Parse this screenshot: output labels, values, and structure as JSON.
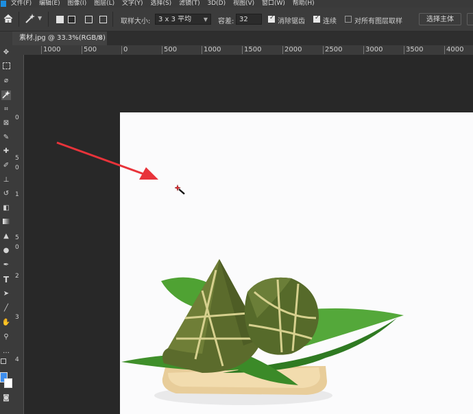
{
  "menubar": {
    "items": [
      "文件(F)",
      "编辑(E)",
      "图像(I)",
      "图层(L)",
      "文字(Y)",
      "选择(S)",
      "滤镜(T)",
      "3D(D)",
      "视图(V)",
      "窗口(W)",
      "帮助(H)"
    ]
  },
  "options": {
    "sample_size_label": "取样大小:",
    "sample_size_value": "3 x 3 平均",
    "tolerance_label": "容差:",
    "tolerance_value": "32",
    "anti_alias_label": "消除锯齿",
    "contiguous_label": "连续",
    "sample_all_label": "对所有图层取样",
    "select_subject_label": "选择主体",
    "anti_alias_checked": true,
    "contiguous_checked": true,
    "sample_all_checked": false
  },
  "document": {
    "tab_title": "素材.jpg @ 33.3%(RGB/8)",
    "close_glyph": "×"
  },
  "ruler": {
    "h_labels": [
      "1000",
      "500",
      "0",
      "500",
      "1000",
      "1500",
      "2000",
      "2500",
      "3000",
      "3500",
      "4000"
    ],
    "v_labels": [
      "0",
      "5",
      "0",
      "1",
      "5",
      "0",
      "2",
      "3",
      "4"
    ]
  },
  "colors": {
    "accent": "#1d8ee0",
    "arrow": "#e8333a"
  }
}
